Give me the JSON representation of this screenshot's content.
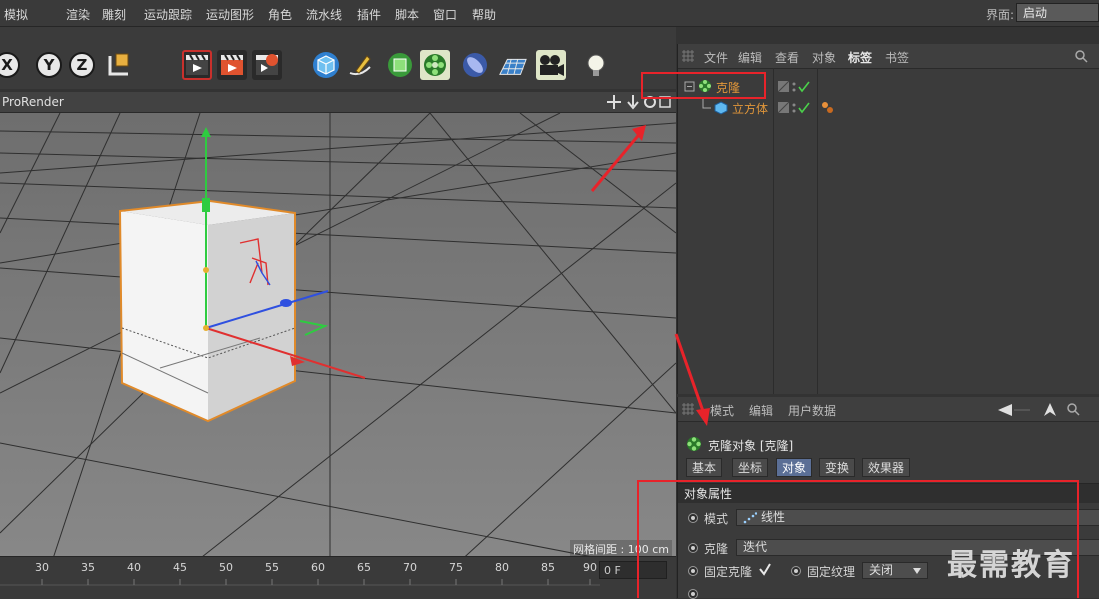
{
  "menubar": {
    "items": [
      "模拟",
      "渲染",
      "雕刻",
      "运动跟踪",
      "运动图形",
      "角色",
      "流水线",
      "插件",
      "脚本",
      "窗口",
      "帮助"
    ],
    "interface_label": "界面:",
    "interface_value": "启动"
  },
  "toolbar": {
    "axis_buttons": [
      "X",
      "Y",
      "Z"
    ]
  },
  "viewport": {
    "title": "ProRender",
    "grid_info": "网格间距 : 100 cm"
  },
  "timeline": {
    "ticks": [
      "30",
      "35",
      "40",
      "45",
      "50",
      "55",
      "60",
      "65",
      "70",
      "75",
      "80",
      "85",
      "90"
    ],
    "frame": "0 F"
  },
  "object_manager": {
    "menu": [
      "文件",
      "编辑",
      "查看",
      "对象",
      "标签",
      "书签"
    ],
    "objects": [
      {
        "name": "克隆",
        "icon": "cloner-icon"
      },
      {
        "name": "立方体",
        "icon": "cube-icon"
      }
    ]
  },
  "attribute_manager": {
    "menu": [
      "模式",
      "编辑",
      "用户数据"
    ],
    "object_title": "克隆对象 [克隆]",
    "tabs": [
      "基本",
      "坐标",
      "对象",
      "变换",
      "效果器"
    ],
    "active_tab": "对象",
    "section_title": "对象属性",
    "properties": {
      "mode_label": "模式",
      "mode_value": "线性",
      "clone_label": "克隆",
      "clone_value": "迭代",
      "fixed_clone_label": "固定克隆",
      "fixed_texture_label": "固定纹理",
      "fixed_texture_value": "关闭"
    }
  },
  "watermark": "最需教育",
  "colors": {
    "accent": "#e0963a",
    "annotation_red": "#e8232a",
    "active_tab": "#5b6f96"
  }
}
